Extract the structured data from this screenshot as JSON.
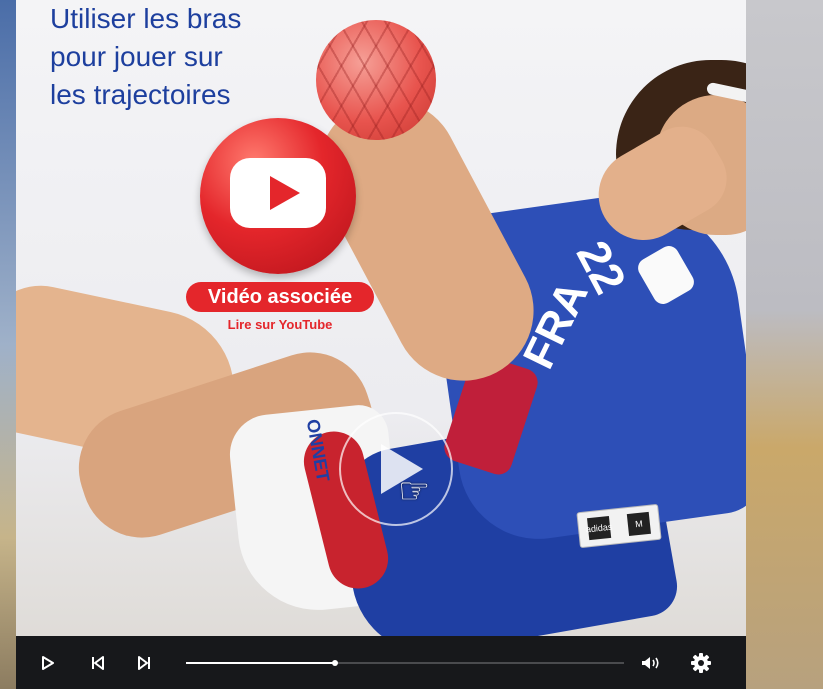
{
  "headline": {
    "lines": [
      "Utiliser les bras",
      "pour jouer sur",
      "les trajectoires"
    ]
  },
  "youtube": {
    "icon": "youtube-play-icon",
    "label": "Vidéo associée",
    "sub": "Lire sur YouTube",
    "color": "#e4262b"
  },
  "photo": {
    "jersey_number": "22",
    "jersey_country": "FRA",
    "shorts_text": "ONNET",
    "sponsor_brand": "adidas",
    "sponsor_size": "M"
  },
  "player_controls": {
    "play_icon": "play-icon",
    "prev_icon": "skip-previous-icon",
    "next_icon": "skip-next-icon",
    "volume_icon": "volume-icon",
    "settings_icon": "gear-icon",
    "progress": 0.34
  },
  "colors": {
    "headline": "#1d3f9e",
    "accent_red": "#e4262b",
    "control_bar": "#17181b"
  }
}
